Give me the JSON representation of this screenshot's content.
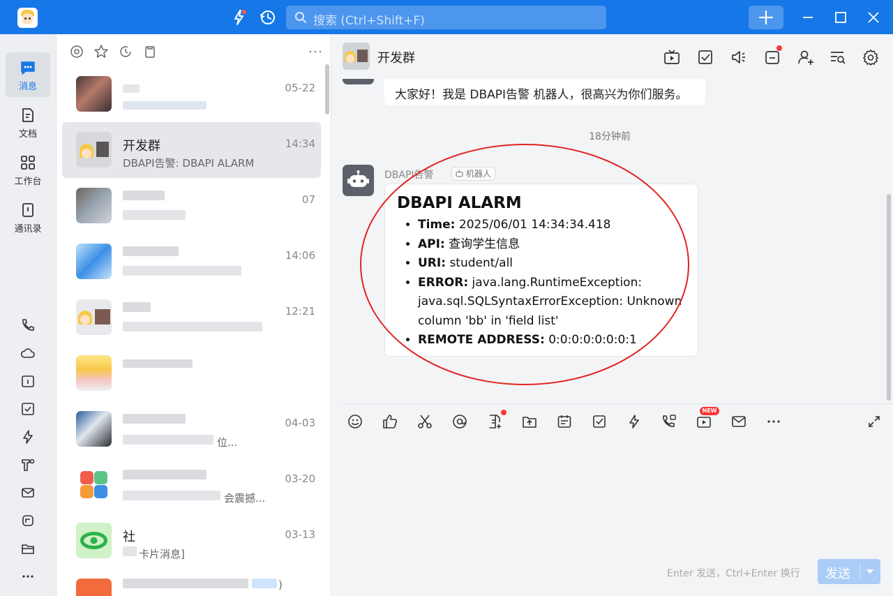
{
  "titlebar": {
    "search_placeholder": "搜索 (Ctrl+Shift+F)"
  },
  "leftnav": {
    "items": [
      {
        "label": "消息",
        "icon": "chat-icon",
        "active": true
      },
      {
        "label": "文档",
        "icon": "document-icon"
      },
      {
        "label": "工作台",
        "icon": "workbench-icon"
      },
      {
        "label": "通讯录",
        "icon": "contacts-icon"
      }
    ],
    "bottom_icons": [
      "phone-icon",
      "cloud-icon",
      "calendar-icon",
      "todo-icon",
      "lightning-icon",
      "tools-icon",
      "mail-icon",
      "meeting-icon",
      "folder-icon",
      "more-icon"
    ]
  },
  "convlist": {
    "filters": [
      "at-icon",
      "star-icon",
      "history-icon",
      "clipboard-icon"
    ],
    "items": [
      {
        "name": "",
        "preview": "",
        "time": "05-22"
      },
      {
        "name": "开发群",
        "preview": "DBAPI告警: DBAPI ALARM",
        "time": "14:34"
      },
      {
        "name": "",
        "preview": "",
        "time": "07"
      },
      {
        "name": "",
        "preview": "",
        "time": "14:06"
      },
      {
        "name": "",
        "preview": "",
        "time": "12:21"
      },
      {
        "name": "",
        "preview": "",
        "time": ""
      },
      {
        "name": "",
        "preview": "位...",
        "time": "04-03"
      },
      {
        "name": "",
        "preview": "会震撼...",
        "time": "03-20"
      },
      {
        "name": "社",
        "preview": "卡片消息]",
        "time": "03-13"
      },
      {
        "name": "",
        "preview": ")",
        "time": ""
      }
    ]
  },
  "chat": {
    "title": "开发群",
    "prev_message": "大家好！我是 DBAPI告警 机器人，很高兴为你们服务。",
    "timestamp": "18分钟前",
    "sender": "DBAPI告警",
    "bot_tag": "机器人",
    "card": {
      "title": "DBAPI ALARM",
      "fields": [
        {
          "key": "Time:",
          "value": "2025/06/01 14:34:34.418"
        },
        {
          "key": "API:",
          "value": "查询学生信息"
        },
        {
          "key": "URI:",
          "value": "student/all"
        },
        {
          "key": "ERROR:",
          "value": "java.lang.RuntimeException: java.sql.SQLSyntaxErrorException: Unknown column 'bb' in 'field list'"
        },
        {
          "key": "REMOTE ADDRESS:",
          "value": "0:0:0:0:0:0:0:1"
        }
      ]
    },
    "toolbar": {
      "new_badge": "NEW"
    },
    "send_hint": "Enter 发送，Ctrl+Enter 换行",
    "send_label": "发送"
  },
  "colors": {
    "brand": "#1677e8",
    "annotation": "#e32222",
    "send_disabled": "#a9cdf7"
  }
}
